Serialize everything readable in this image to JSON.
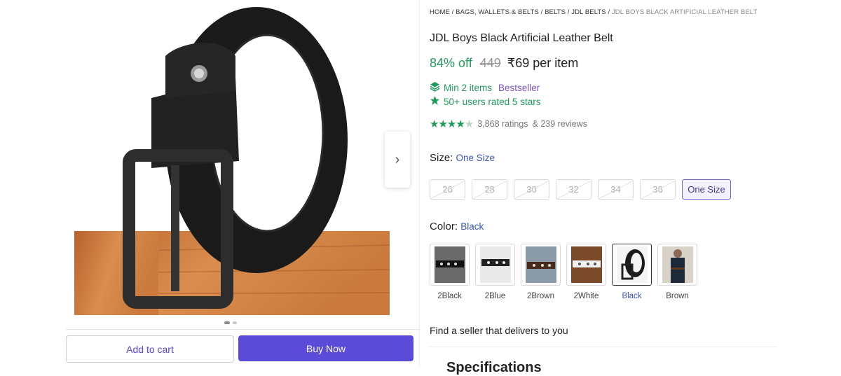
{
  "breadcrumb": {
    "items": [
      "HOME",
      "BAGS, WALLETS & BELTS",
      "BELTS",
      "JDL BELTS"
    ],
    "current": "JDL BOYS BLACK ARTIFICIAL LEATHER BELT"
  },
  "product": {
    "title": "JDL Boys Black Artificial Leather Belt",
    "discount": "84% off",
    "mrp": "449",
    "price": "₹69 per item",
    "min_items": "Min 2 items",
    "bestseller": "Bestseller",
    "rated_text": "50+ users rated 5 stars",
    "ratings": "3,868 ratings",
    "reviews": "& 239 reviews",
    "star_rating": 4.5
  },
  "size": {
    "label": "Size:",
    "selected": "One Size",
    "options": [
      "26",
      "28",
      "30",
      "32",
      "34",
      "36",
      "One Size"
    ]
  },
  "color": {
    "label": "Color:",
    "selected": "Black",
    "options": [
      "2Black",
      "2Blue",
      "2Brown",
      "2White",
      "Black",
      "Brown"
    ]
  },
  "gallery": {
    "dots_total": 2,
    "dots_active": 0
  },
  "actions": {
    "add_to_cart": "Add to cart",
    "buy_now": "Buy Now"
  },
  "seller": {
    "text": "Find a seller that delivers to you"
  },
  "specifications": {
    "title": "Specifications"
  },
  "colors": {
    "accent": "#5a4bd8",
    "green": "#1f9b5a",
    "link_blue": "#3b55b8"
  }
}
